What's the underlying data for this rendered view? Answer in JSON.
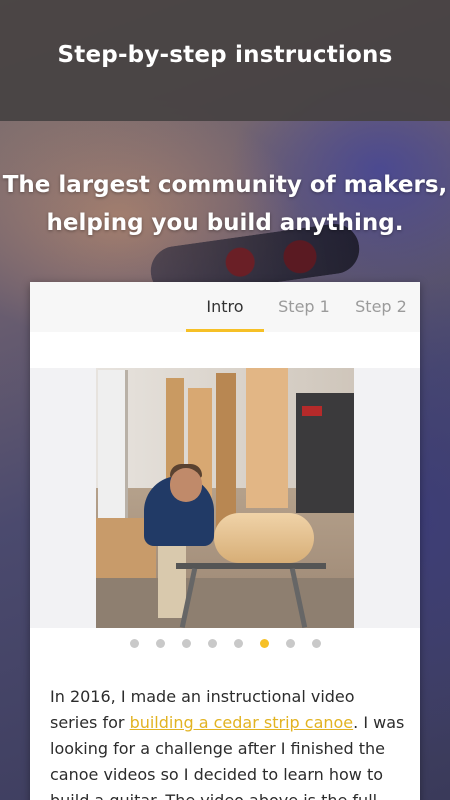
{
  "header": {
    "title": "Step-by-step instructions"
  },
  "hero": {
    "line1": "The largest community of makers,",
    "line2": "helping you build anything."
  },
  "tabs": [
    {
      "label": "Intro",
      "active": true
    },
    {
      "label": "Step 1",
      "active": false
    },
    {
      "label": "Step 2",
      "active": false
    }
  ],
  "gallery": {
    "image_description": "photo",
    "dots_total": 8,
    "active_dot_index": 5
  },
  "intro": {
    "text_before_link": "In 2016, I made an instructional video series for ",
    "link_text": "building a cedar strip canoe",
    "text_after_link": ". I was looking for a challenge after I finished the canoe videos so I decided to learn how to build a guitar. The video above is the full montage of"
  },
  "colors": {
    "accent": "#f6c026",
    "header_bg": "#464242",
    "link": "#e2b322"
  }
}
